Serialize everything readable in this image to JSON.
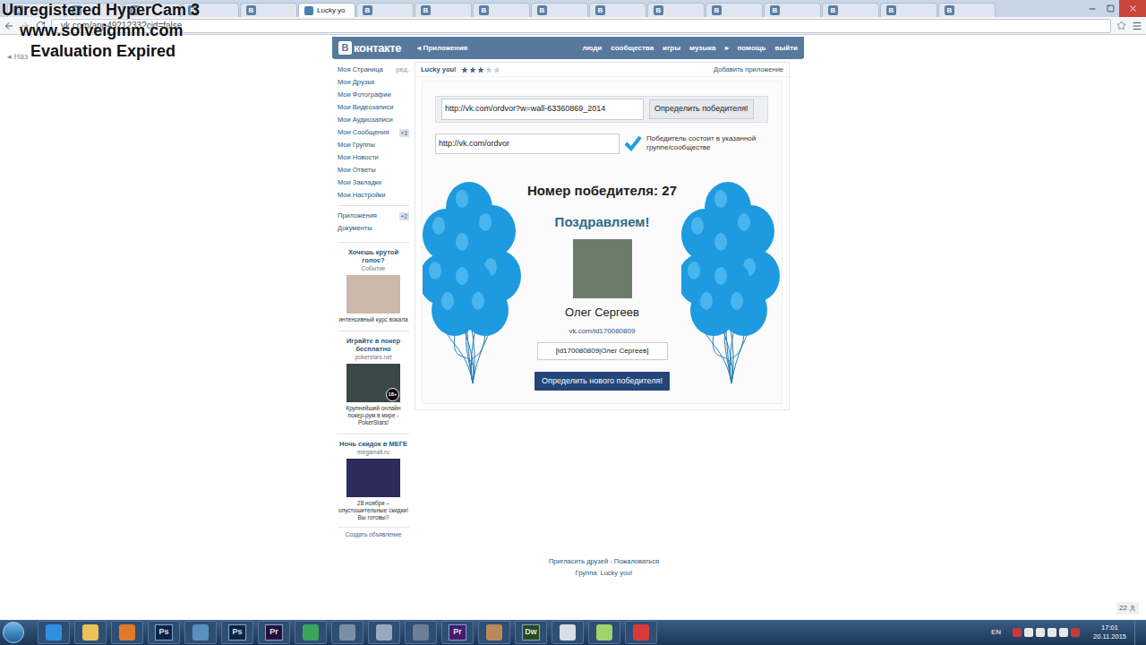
{
  "watermark": [
    "Unregistered HyperCam 3",
    "www.solveigmm.com",
    "Evaluation Expired"
  ],
  "browser": {
    "tabs": [
      {
        "kind": "vk",
        "icon": "В",
        "selected": false
      },
      {
        "kind": "vk",
        "icon": "В",
        "selected": false
      },
      {
        "kind": "vk",
        "icon": "В",
        "selected": false
      },
      {
        "kind": "vk",
        "icon": "В",
        "selected": false
      },
      {
        "kind": "vk",
        "icon": "В",
        "selected": false
      },
      {
        "kind": "app",
        "label": "Lucky yo",
        "selected": true
      },
      {
        "kind": "vk",
        "icon": "В",
        "selected": false
      },
      {
        "kind": "vk",
        "icon": "В",
        "selected": false
      },
      {
        "kind": "vk",
        "icon": "В",
        "selected": false
      },
      {
        "kind": "vk",
        "icon": "В",
        "selected": false
      },
      {
        "kind": "vk",
        "icon": "В",
        "selected": false
      },
      {
        "kind": "vk",
        "icon": "В",
        "selected": false
      },
      {
        "kind": "vk",
        "icon": "В",
        "selected": false
      },
      {
        "kind": "vk",
        "icon": "В",
        "selected": false
      },
      {
        "kind": "vk",
        "icon": "В",
        "selected": false
      },
      {
        "kind": "vk",
        "icon": "В",
        "selected": false
      },
      {
        "kind": "vk",
        "icon": "В",
        "selected": false
      }
    ],
    "address": "vk.com/app4921233?cid=false",
    "back_link": "Наз"
  },
  "vk": {
    "logo": {
      "mark": "В",
      "text": "контакте"
    },
    "section": "Приложения",
    "nav": [
      "люди",
      "сообщества",
      "игры",
      "музыка",
      "▸",
      "помощь",
      "выйти"
    ],
    "menu": [
      {
        "label": "Моя Страница",
        "extra": "ред."
      },
      {
        "label": "Мои Друзья"
      },
      {
        "label": "Мои Фотографии"
      },
      {
        "label": "Мои Видеозаписи"
      },
      {
        "label": "Мои Аудиозаписи"
      },
      {
        "label": "Мои Сообщения",
        "count": "+3"
      },
      {
        "label": "Мои Группы"
      },
      {
        "label": "Мои Новости"
      },
      {
        "label": "Мои Ответы"
      },
      {
        "label": "Мои Закладки"
      },
      {
        "label": "Мои Настройки"
      }
    ],
    "menu2": [
      {
        "label": "Приложения",
        "count": "+2"
      },
      {
        "label": "Документы"
      }
    ],
    "ads": [
      {
        "title": "Хочешь крутой голос?",
        "subtitle": "Событие",
        "text": "интенсивный курс вокала",
        "color": "#cdb8ab"
      },
      {
        "title": "Играйте в покер бесплатно",
        "subtitle": "pokerstars.net",
        "text": "Крупнейший онлайн покер-рум в мире - PokerStars!",
        "color": "#3b4848",
        "badge": "18+"
      },
      {
        "title": "Ночь скидок в МЕГЕ",
        "subtitle": "megamall.ru",
        "text": "28 ноября – опустошительные скидки! Вы готовы?",
        "color": "#2c2b5c"
      }
    ],
    "create_ad": "Создать объявление",
    "footer": {
      "links": "Пригласить друзей - Пожаловаться",
      "group": "Группа: Lucky you!"
    }
  },
  "app": {
    "title": "Lucky you!",
    "stars": 3,
    "add": "Добавить приложение",
    "post_url": "http://vk.com/ordvor?w=wall-63360869_2014",
    "find_button": "Определить победителя!",
    "group_url": "http://vk.com/ordvor",
    "member_check": {
      "checked": true,
      "label": "Победитель состоит в указанной группе/сообществе"
    },
    "winner_label": "Номер победителя:",
    "winner_number": "27",
    "congrats": "Поздравляем!",
    "winner_name": "Олег Сергеев",
    "winner_link": "vk.com/id170080809",
    "winner_code": "[id170080809|Олег Сергеев]",
    "new_button": "Определить нового победителя!"
  },
  "online_badge": "22",
  "taskbar": {
    "items": [
      {
        "kind": "tile",
        "color": "#2f8fe0"
      },
      {
        "kind": "tile",
        "color": "#e8c25a"
      },
      {
        "kind": "tile",
        "color": "#e07a2a"
      },
      {
        "kind": "text",
        "label": "Ps",
        "color": "#0d2440"
      },
      {
        "kind": "tile",
        "color": "#5a8fbf"
      },
      {
        "kind": "text",
        "label": "Ps",
        "color": "#0d2440"
      },
      {
        "kind": "text",
        "label": "Pr",
        "color": "#2b0d3a"
      },
      {
        "kind": "tile",
        "color": "#3ba55c"
      },
      {
        "kind": "tile",
        "color": "#7a8fa6"
      },
      {
        "kind": "tile",
        "color": "#9aa9bb"
      },
      {
        "kind": "tile",
        "color": "#6d7f96"
      },
      {
        "kind": "text",
        "label": "Pr",
        "color": "#4a1a6a"
      },
      {
        "kind": "tile",
        "color": "#b88a5a"
      },
      {
        "kind": "text",
        "label": "Dw",
        "color": "#2a4a1a"
      },
      {
        "kind": "tile",
        "color": "#d8dde6"
      },
      {
        "kind": "tile",
        "color": "#9fd36b"
      },
      {
        "kind": "tile",
        "color": "#d93a3a"
      }
    ],
    "language": "EN",
    "tray": [
      {
        "color": "#c43a3a"
      },
      {
        "color": "#e8e8e8"
      },
      {
        "color": "#e8e8e8"
      },
      {
        "color": "#e8e8e8"
      },
      {
        "color": "#e8e8e8"
      },
      {
        "color": "#c43a3a"
      }
    ],
    "time": "17:01",
    "date": "20.11.2015"
  }
}
